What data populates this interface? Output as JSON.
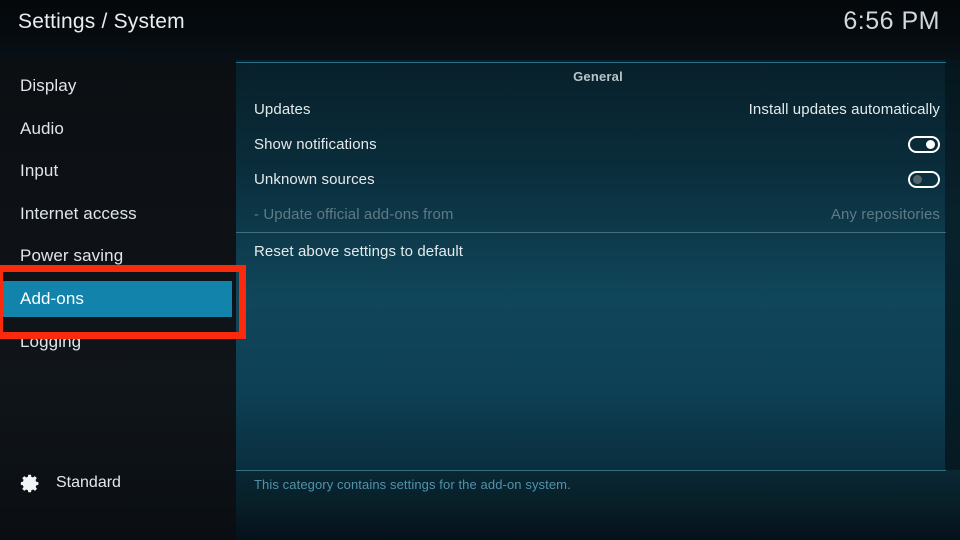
{
  "header": {
    "title": "Settings / System",
    "clock": "6:56 PM"
  },
  "sidebar": {
    "items": [
      {
        "label": "Display",
        "selected": false
      },
      {
        "label": "Audio",
        "selected": false
      },
      {
        "label": "Input",
        "selected": false
      },
      {
        "label": "Internet access",
        "selected": false
      },
      {
        "label": "Power saving",
        "selected": false
      },
      {
        "label": "Add-ons",
        "selected": true
      },
      {
        "label": "Logging",
        "selected": false
      }
    ],
    "profile": {
      "icon": "gear-icon",
      "label": "Standard"
    }
  },
  "panel": {
    "group_header": "General",
    "rows": [
      {
        "label": "Updates",
        "value": "Install updates automatically",
        "control": "text",
        "disabled": false
      },
      {
        "label": "Show notifications",
        "value": "on",
        "control": "toggle",
        "disabled": false
      },
      {
        "label": "Unknown sources",
        "value": "off",
        "control": "toggle",
        "disabled": false
      },
      {
        "label": "- Update official add-ons from",
        "value": "Any repositories",
        "control": "text",
        "disabled": true
      },
      {
        "label": "Reset above settings to default",
        "value": "",
        "control": "none",
        "disabled": false
      }
    ]
  },
  "description": {
    "text": "This category contains settings for the add-on system."
  },
  "annotation": {
    "name": "add-ons-highlight",
    "color": "#fa2b0c"
  },
  "colors": {
    "accent_selected": "#1284ab",
    "panel_top_rule": "#2f7e99",
    "description_text": "#4f93ab",
    "annotation": "#fa2b0c"
  }
}
